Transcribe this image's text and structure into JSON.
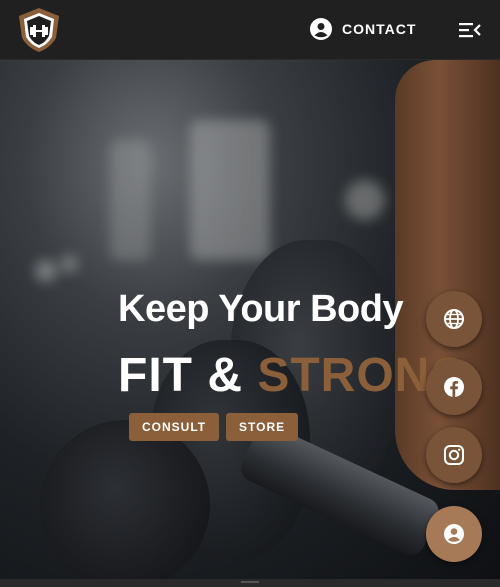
{
  "navbar": {
    "contact_label": "CONTACT",
    "logo_icon": "dumbbell-shield-logo",
    "menu_icon": "menu-arrow-icon"
  },
  "hero": {
    "title_line1": "Keep Your Body",
    "title_line2_white": "FIT & ",
    "title_line2_accent": "STRONG",
    "consult_label": "CONSULT",
    "store_label": "STORE"
  },
  "floating_buttons": [
    {
      "icon": "globe-icon"
    },
    {
      "icon": "facebook-icon"
    },
    {
      "icon": "instagram-icon"
    },
    {
      "icon": "user-icon"
    }
  ],
  "colors": {
    "accent": "#8a5f3a",
    "navbar_bg": "#202020",
    "text": "#ffffff"
  }
}
